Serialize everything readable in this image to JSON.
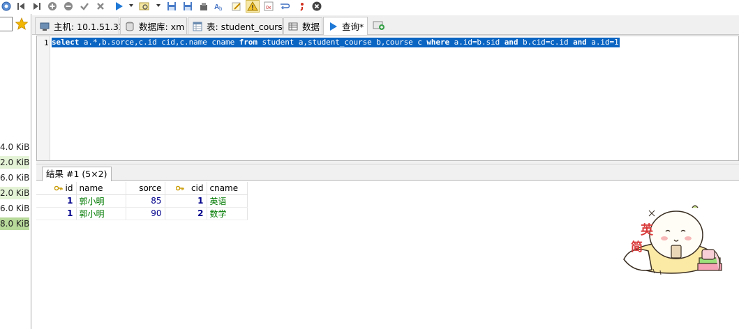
{
  "toolbar": {
    "buttons": [
      {
        "name": "refresh-icon",
        "glyph": "◎"
      },
      {
        "name": "first-record-icon",
        "glyph": "⏮"
      },
      {
        "name": "last-record-icon",
        "glyph": "⏭"
      },
      {
        "name": "add-record-icon",
        "glyph": "+"
      },
      {
        "name": "delete-record-icon",
        "glyph": "−"
      },
      {
        "name": "confirm-icon",
        "glyph": "✔"
      },
      {
        "name": "cancel-icon",
        "glyph": "✖"
      },
      {
        "name": "run-icon",
        "glyph": "▶"
      },
      {
        "name": "find-icon",
        "glyph": "🔍"
      },
      {
        "name": "save-icon"
      },
      {
        "name": "save-as-icon"
      },
      {
        "name": "tools-icon"
      },
      {
        "name": "format-sql-icon"
      },
      {
        "name": "edit-icon"
      },
      {
        "name": "warning-icon"
      },
      {
        "name": "hex-icon"
      },
      {
        "name": "wrap-icon"
      },
      {
        "name": "semicolon-icon"
      },
      {
        "name": "stop-icon"
      }
    ]
  },
  "left_panel": {
    "sizes": [
      "4.0 KiB",
      "2.0 KiB",
      "6.0 KiB",
      "2.0 KiB",
      "6.0 KiB",
      "8.0 KiB"
    ],
    "highlight_colors": [
      "#ffffff",
      "#e4f3d6",
      "#ffffff",
      "#e4f3d6",
      "#ffffff",
      "#b7d99a"
    ]
  },
  "tabs": [
    {
      "label": "主机: 10.1.51.31",
      "icon": "host-icon"
    },
    {
      "label": "数据库: xm",
      "icon": "database-icon"
    },
    {
      "label": "表: student_course",
      "icon": "table-icon"
    },
    {
      "label": "数据",
      "icon": "data-grid-icon"
    },
    {
      "label": "查询*",
      "icon": "query-play-icon",
      "active": true
    }
  ],
  "editor": {
    "line_number": "1",
    "sql_parts": [
      {
        "t": "select",
        "kw": true
      },
      {
        "t": " a.*,b.sorce,c.id cid,c.name cname ",
        "kw": false
      },
      {
        "t": "from",
        "kw": true
      },
      {
        "t": " student a,student_course b,course c ",
        "kw": false
      },
      {
        "t": "where",
        "kw": true
      },
      {
        "t": " a.id=b.sid ",
        "kw": false
      },
      {
        "t": "and",
        "kw": true
      },
      {
        "t": " b.cid=c.id ",
        "kw": false
      },
      {
        "t": "and",
        "kw": true
      },
      {
        "t": " a.id=1",
        "kw": false
      }
    ],
    "selection_color": "#0a64c2"
  },
  "results": {
    "tab_label": "结果 #1 (5×2)",
    "columns": [
      {
        "label": "id",
        "key": true
      },
      {
        "label": "name",
        "key": false
      },
      {
        "label": "sorce",
        "key": false
      },
      {
        "label": "cid",
        "key": true
      },
      {
        "label": "cname",
        "key": false
      }
    ],
    "rows": [
      [
        "1",
        "郭小明",
        "85",
        "1",
        "英语"
      ],
      [
        "1",
        "郭小明",
        "90",
        "2",
        "数学"
      ]
    ]
  },
  "sticker": {
    "chars": [
      "英",
      "简"
    ]
  }
}
